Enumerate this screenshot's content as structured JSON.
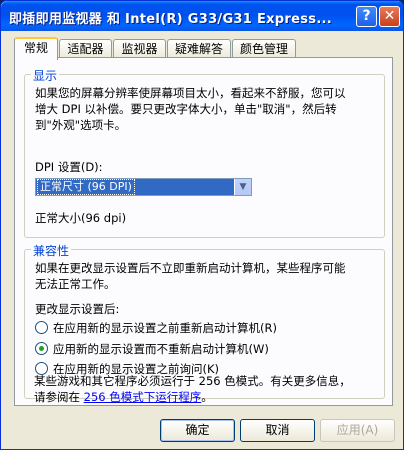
{
  "window": {
    "title": "即插即用监视器 和 Intel(R) G33/G31 Express...",
    "help_button": "?",
    "close_button": "✕"
  },
  "tabs": [
    {
      "label": "常规"
    },
    {
      "label": "适配器"
    },
    {
      "label": "监视器"
    },
    {
      "label": "疑难解答"
    },
    {
      "label": "颜色管理"
    }
  ],
  "display_group": {
    "label": "显示",
    "description_line1": "如果您的屏幕分辨率使屏幕项目太小，看起来不舒服，您可以",
    "description_line2": "增大 DPI 以补偿。要只更改字体大小，单击\"取消\"，然后转",
    "description_line3": "到\"外观\"选项卡。",
    "dpi_label": "DPI 设置(D):",
    "dpi_value": "正常尺寸 (96 DPI)",
    "dpi_note": "正常大小(96 dpi)"
  },
  "compat_group": {
    "label": "兼容性",
    "description_line1": "如果在更改显示设置后不立即重新启动计算机，某些程序可能",
    "description_line2": "无法正常工作。",
    "after_change_label": "更改显示设置后:",
    "options": [
      {
        "label": "在应用新的显示设置之前重新启动计算机(R)",
        "checked": false
      },
      {
        "label": "应用新的显示设置而不重新启动计算机(W)",
        "checked": true
      },
      {
        "label": "在应用新的显示设置之前询问(K)",
        "checked": false
      }
    ],
    "footer_line1": "某些游戏和其它程序必须运行于 256 色模式。有关更多信息，",
    "footer_line2_prefix": "请参阅在 ",
    "footer_link": "256 色模式下运行程序",
    "footer_line2_suffix": "。"
  },
  "buttons": {
    "ok": "确定",
    "cancel": "取消",
    "apply": "应用(A)"
  }
}
